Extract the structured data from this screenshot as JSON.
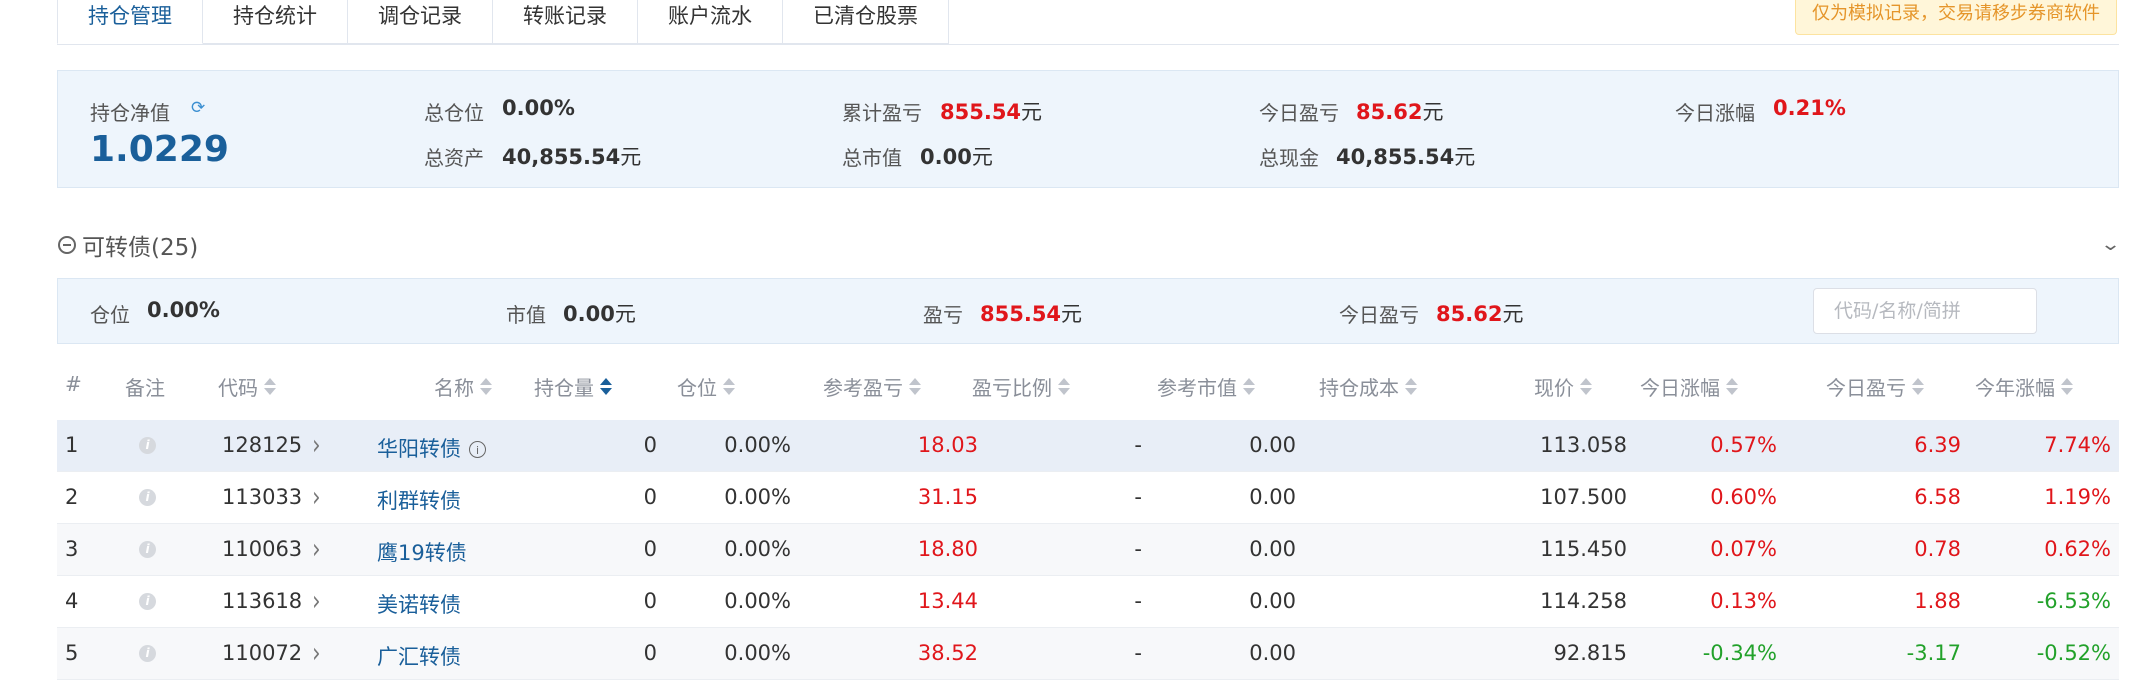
{
  "tabs": [
    "持仓管理",
    "持仓统计",
    "调仓记录",
    "转账记录",
    "账户流水",
    "已清仓股票"
  ],
  "notice": "仅为模拟记录，交易请移步券商软件",
  "summary": {
    "nav_label": "持仓净值",
    "nav_value": "1.0229",
    "total_position_label": "总仓位",
    "total_position_value": "0.00%",
    "total_assets_label": "总资产",
    "total_assets_value": "40,855.54",
    "cum_pnl_label": "累计盈亏",
    "cum_pnl_value": "855.54",
    "total_mv_label": "总市值",
    "total_mv_value": "0.00",
    "today_pnl_label": "今日盈亏",
    "today_pnl_value": "85.62",
    "total_cash_label": "总现金",
    "total_cash_value": "40,855.54",
    "today_chg_label": "今日涨幅",
    "today_chg_value": "0.21%",
    "unit": "元"
  },
  "section": {
    "title": "可转债(25)",
    "position_label": "仓位",
    "position_value": "0.00%",
    "mv_label": "市值",
    "mv_value": "0.00",
    "pnl_label": "盈亏",
    "pnl_value": "855.54",
    "today_pnl_label": "今日盈亏",
    "today_pnl_value": "85.62",
    "search_placeholder": "代码/名称/简拼"
  },
  "columns": [
    "#",
    "备注",
    "代码",
    "名称",
    "持仓量",
    "仓位",
    "参考盈亏",
    "盈亏比例",
    "参考市值",
    "持仓成本",
    "现价",
    "今日涨幅",
    "今日盈亏",
    "今年涨幅"
  ],
  "rows": [
    {
      "idx": "1",
      "code": "128125",
      "name": "华阳转债",
      "qty": "0",
      "pos": "0.00%",
      "pnl": "18.03",
      "ratio": "-",
      "mv": "0.00",
      "cost": "",
      "price": "113.058",
      "chg": "0.57%",
      "tpnl": "6.39",
      "ytd": "7.74%",
      "ytd_dir": "up"
    },
    {
      "idx": "2",
      "code": "113033",
      "name": "利群转债",
      "qty": "0",
      "pos": "0.00%",
      "pnl": "31.15",
      "ratio": "-",
      "mv": "0.00",
      "cost": "",
      "price": "107.500",
      "chg": "0.60%",
      "tpnl": "6.58",
      "ytd": "1.19%",
      "ytd_dir": "up"
    },
    {
      "idx": "3",
      "code": "110063",
      "name": "鹰19转债",
      "qty": "0",
      "pos": "0.00%",
      "pnl": "18.80",
      "ratio": "-",
      "mv": "0.00",
      "cost": "",
      "price": "115.450",
      "chg": "0.07%",
      "tpnl": "0.78",
      "ytd": "0.62%",
      "ytd_dir": "up"
    },
    {
      "idx": "4",
      "code": "113618",
      "name": "美诺转债",
      "qty": "0",
      "pos": "0.00%",
      "pnl": "13.44",
      "ratio": "-",
      "mv": "0.00",
      "cost": "",
      "price": "114.258",
      "chg": "0.13%",
      "tpnl": "1.88",
      "ytd": "-6.53%",
      "ytd_dir": "down"
    },
    {
      "idx": "5",
      "code": "110072",
      "name": "广汇转债",
      "qty": "0",
      "pos": "0.00%",
      "pnl": "38.52",
      "ratio": "-",
      "mv": "0.00",
      "cost": "",
      "price": "92.815",
      "chg": "-0.34%",
      "tpnl": "-3.17",
      "ytd": "-0.52%",
      "ytd_dir": "down"
    }
  ]
}
